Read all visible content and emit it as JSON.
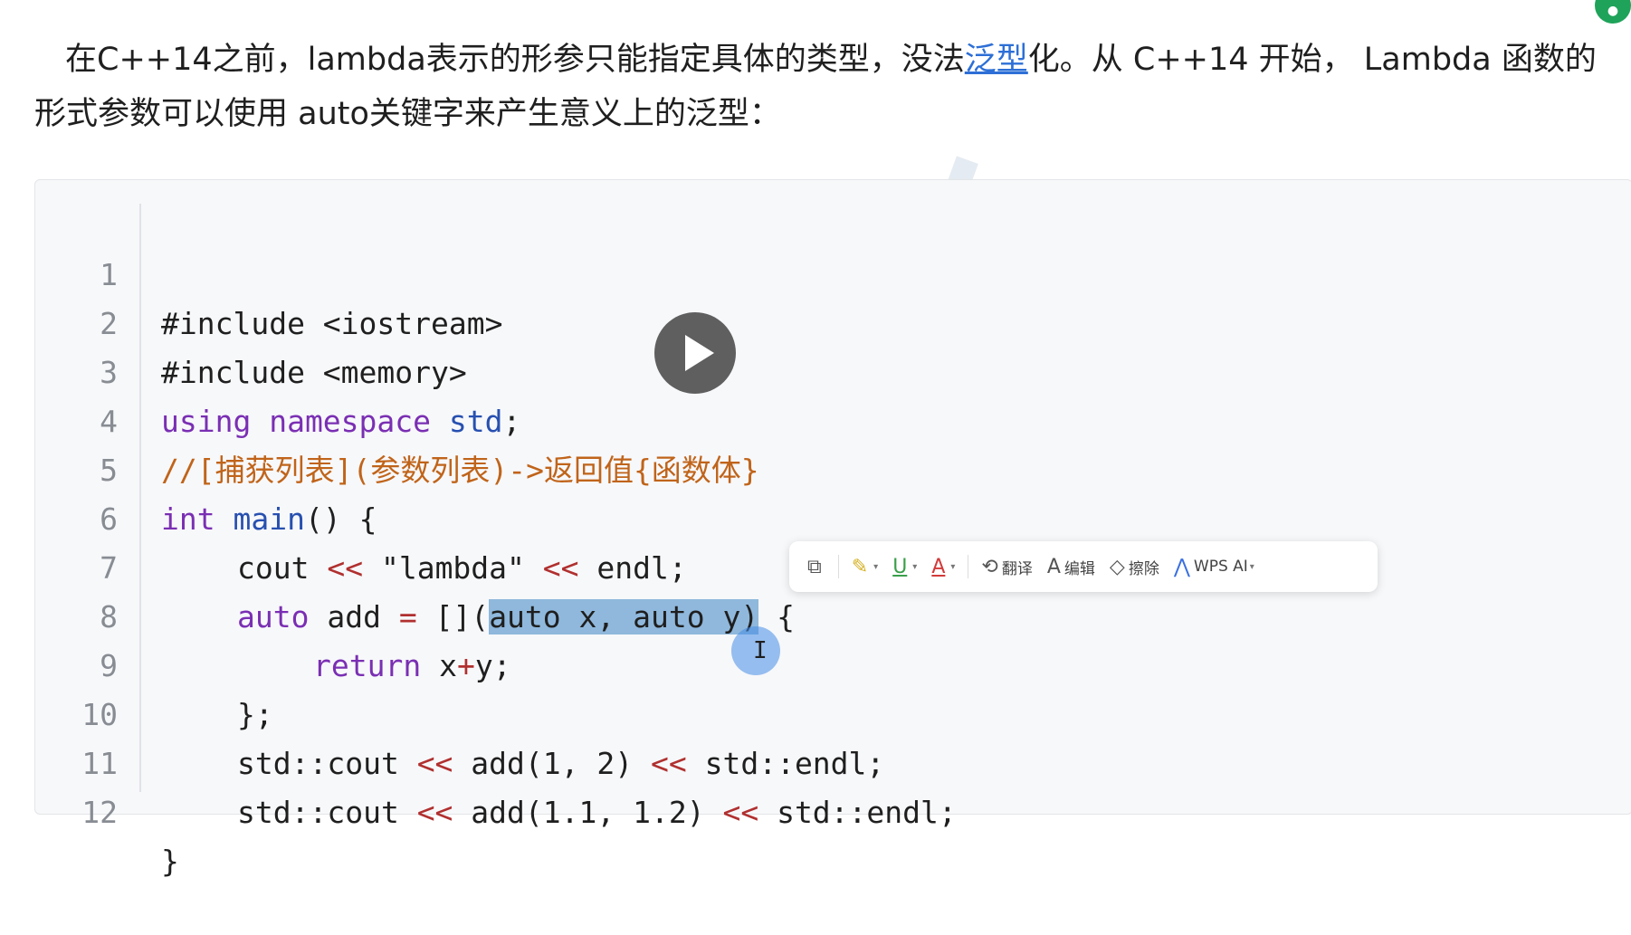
{
  "paragraph": {
    "before_link": "在C++14之前，lambda表示的形参只能指定具体的类型，没法",
    "link": "泛型",
    "after_link": "化。从 C++14 开始， Lambda 函数的形式参数可以使用 auto关键字来产生意义上的泛型："
  },
  "code": {
    "line_numbers": [
      "1",
      "2",
      "3",
      "4",
      "5",
      "6",
      "7",
      "8",
      "9",
      "10",
      "11",
      "12"
    ],
    "l1": {
      "text": "#include <iostream>"
    },
    "l2": {
      "text": "#include <memory>"
    },
    "l3": {
      "kw": "using namespace",
      "ns": "std",
      "rest": ";"
    },
    "l4": {
      "comment": "//[捕获列表](参数列表)->返回值{函数体}"
    },
    "l5": {
      "kw": "int",
      "name": "main",
      "rest": "() {"
    },
    "l6": {
      "a": "cout ",
      "op1": "<<",
      "str": " \"lambda\" ",
      "op2": "<<",
      "b": " endl;"
    },
    "l7": {
      "kw": "auto",
      "a": " add ",
      "op": "=",
      "b": " [](",
      "sel": "auto x, auto y)",
      "c": " {"
    },
    "l8": {
      "kw": "return",
      "a": " x",
      "op": "+",
      "b": "y;"
    },
    "l9": {
      "text": "};"
    },
    "l10": {
      "a": "std::cout ",
      "op1": "<<",
      "b": " add(1, 2) ",
      "op2": "<<",
      "c": " std::endl;"
    },
    "l11": {
      "a": "std::cout ",
      "op1": "<<",
      "b": " add(1.1, 1.2) ",
      "op2": "<<",
      "c": " std::endl;"
    },
    "l12": {
      "text": "}"
    }
  },
  "toolbar": {
    "copy_icon": "copy-icon",
    "highlight_icon": "highlighter-icon",
    "underline_icon": "underline-icon",
    "font_color_icon": "font-color-icon",
    "translate": "翻译",
    "edit": "编辑",
    "erase": "擦除",
    "wps_ai": "WPS AI"
  },
  "colors": {
    "keyword": "#7a2fb3",
    "namespace": "#2750b0",
    "comment": "#c0641a",
    "operator": "#b0302f",
    "selection": "#8fb8dc",
    "link": "#2d6fd6"
  }
}
